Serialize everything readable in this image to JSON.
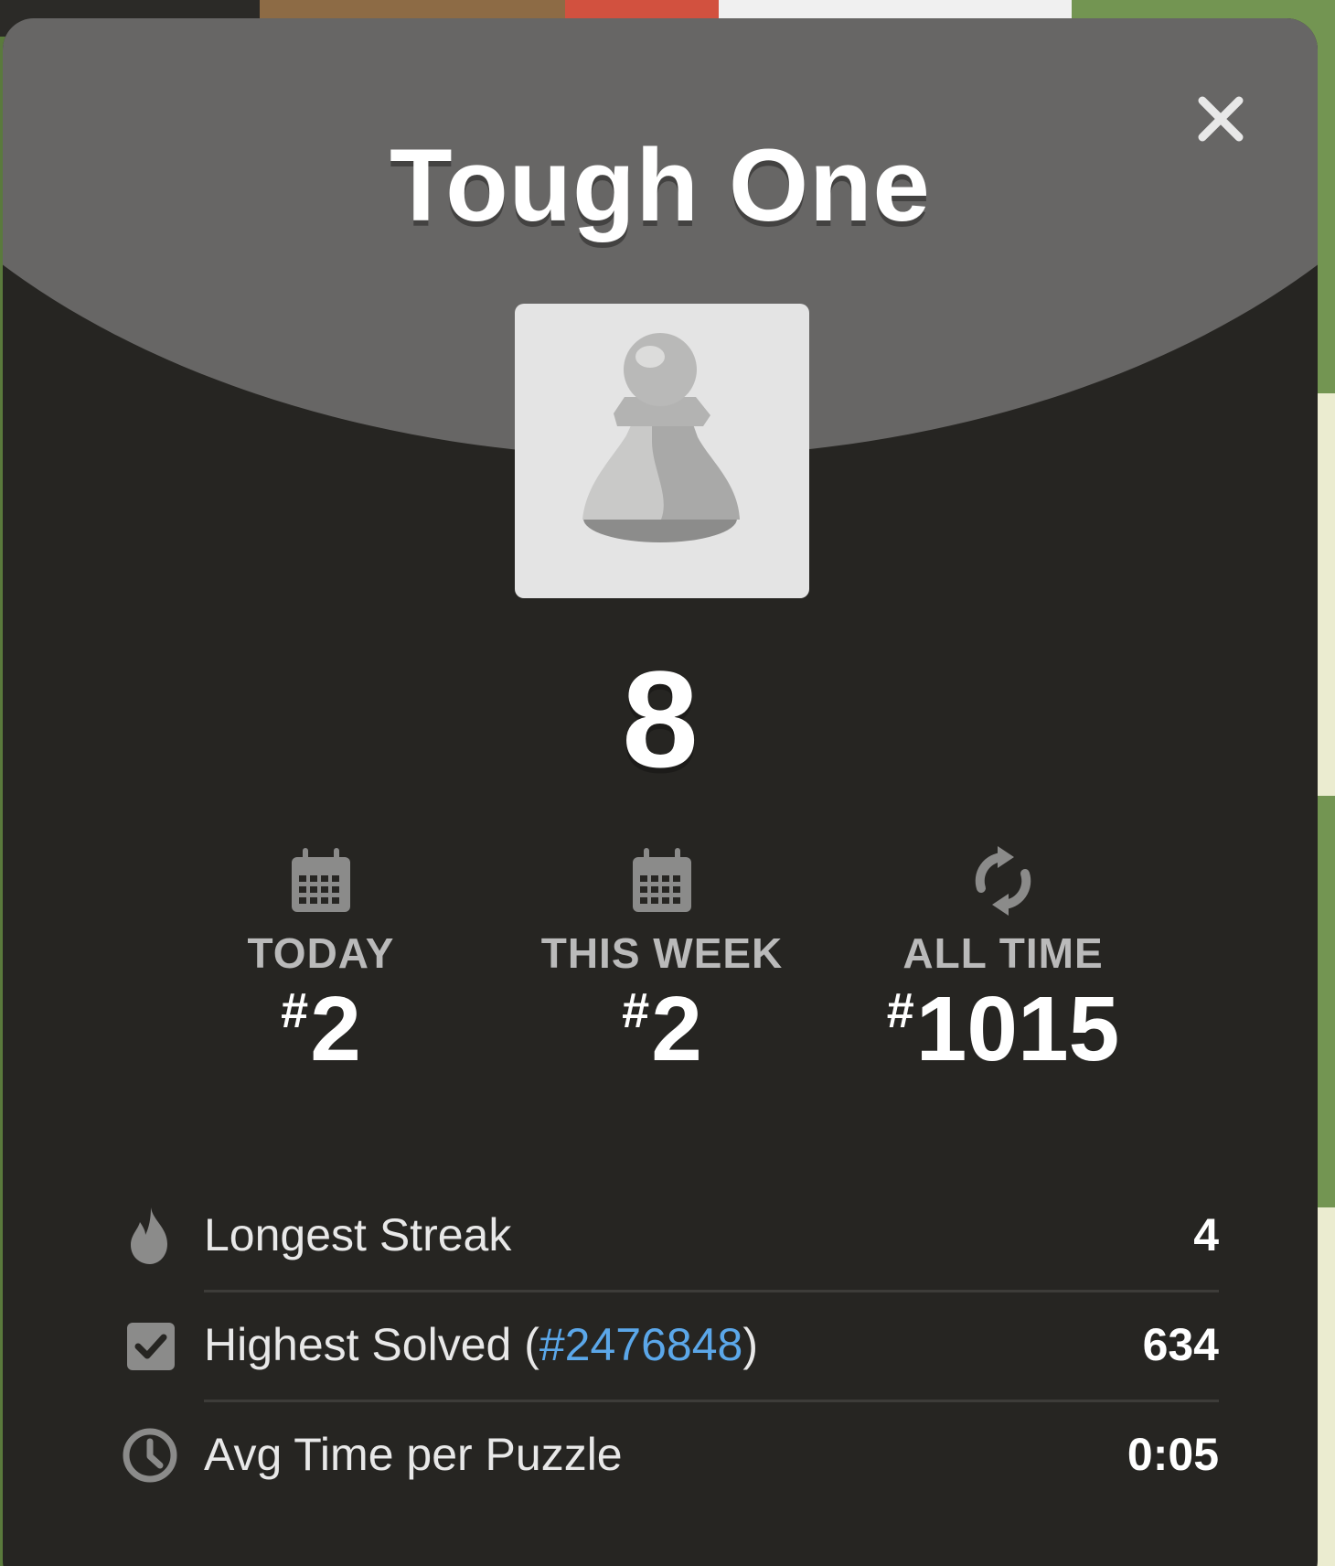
{
  "modal": {
    "title": "Tough One",
    "score": "8",
    "close_icon": "close-icon",
    "piece_icon": "pawn-icon"
  },
  "ranks": [
    {
      "icon": "calendar-icon",
      "label": "TODAY",
      "hash": "#",
      "value": "2"
    },
    {
      "icon": "calendar-icon",
      "label": "THIS WEEK",
      "hash": "#",
      "value": "2"
    },
    {
      "icon": "refresh-icon",
      "label": "ALL TIME",
      "hash": "#",
      "value": "1015"
    }
  ],
  "stats": {
    "longest_streak": {
      "icon": "flame-icon",
      "label": "Longest Streak",
      "value": "4"
    },
    "highest_solved": {
      "icon": "checkbox-icon",
      "label_prefix": "Highest Solved (",
      "link": "#2476848",
      "label_suffix": ")",
      "value": "634"
    },
    "avg_time": {
      "icon": "clock-icon",
      "label": "Avg Time per Puzzle",
      "value": "0:05"
    }
  },
  "colors": {
    "header": "#676665",
    "body": "#262522",
    "link": "#5ba7e9",
    "muted": "#bababa"
  }
}
